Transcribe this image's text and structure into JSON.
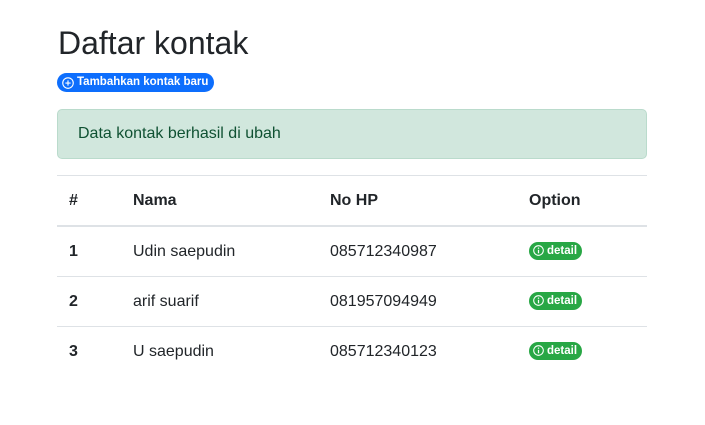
{
  "page": {
    "title": "Daftar kontak",
    "add_button_label": "Tambahkan kontak baru",
    "alert_text": "Data kontak berhasil di ubah"
  },
  "table": {
    "headers": [
      "#",
      "Nama",
      "No HP",
      "Option"
    ],
    "rows": [
      {
        "num": "1",
        "name": "Udin saepudin",
        "hp": "085712340987",
        "action": "detail"
      },
      {
        "num": "2",
        "name": "arif suarif",
        "hp": "081957094949",
        "action": "detail"
      },
      {
        "num": "3",
        "name": "U saepudin",
        "hp": "085712340123",
        "action": "detail"
      }
    ]
  },
  "icons": {
    "add": "plus-circle-icon",
    "detail": "info-circle-icon"
  },
  "colors": {
    "primary": "#0d6efd",
    "success": "#28a745",
    "alert_bg": "#d1e7dd",
    "alert_text": "#0f5132"
  }
}
